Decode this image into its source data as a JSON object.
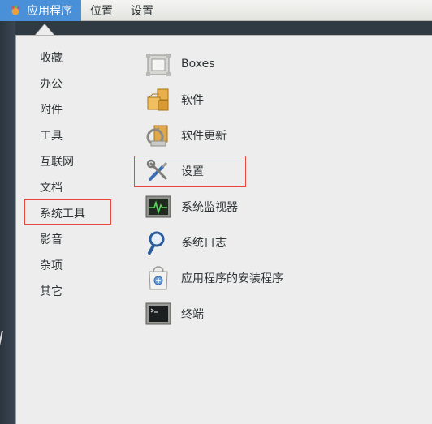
{
  "topbar": {
    "applications": "应用程序",
    "places": "位置",
    "settings": "设置"
  },
  "categories": [
    "收藏",
    "办公",
    "附件",
    "工具",
    "互联网",
    "文档",
    "系统工具",
    "影音",
    "杂项",
    "其它"
  ],
  "highlighted_category": "系统工具",
  "apps": [
    {
      "label": "Boxes",
      "icon": "boxes-icon"
    },
    {
      "label": "软件",
      "icon": "software-icon"
    },
    {
      "label": "软件更新",
      "icon": "software-update-icon"
    },
    {
      "label": "设置",
      "icon": "settings-tools-icon"
    },
    {
      "label": "系统监视器",
      "icon": "system-monitor-icon"
    },
    {
      "label": "系统日志",
      "icon": "system-log-icon"
    },
    {
      "label": "应用程序的安装程序",
      "icon": "app-installer-icon"
    },
    {
      "label": "终端",
      "icon": "terminal-icon"
    }
  ],
  "highlighted_app": "设置",
  "colors": {
    "accent": "#4a90d9",
    "highlight_border": "#e8473d",
    "menu_bg": "#ededed"
  }
}
